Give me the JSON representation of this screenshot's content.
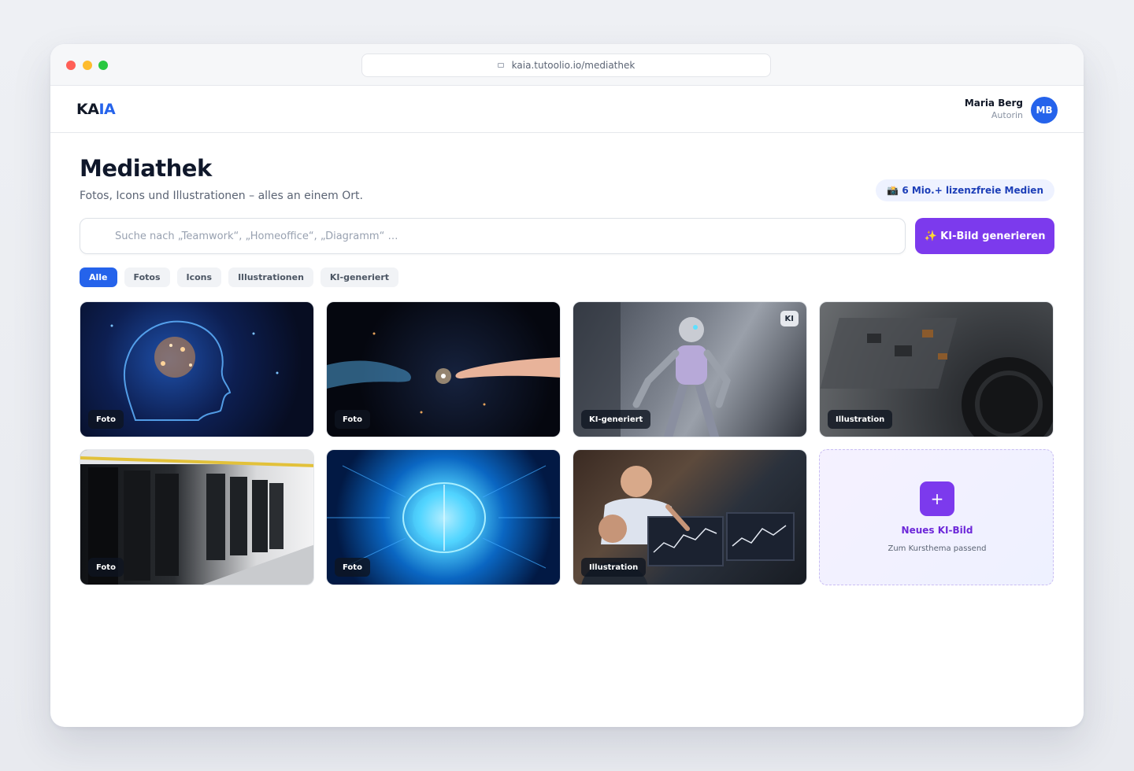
{
  "browser": {
    "url": "kaia.tutoolio.io/mediathek"
  },
  "header": {
    "logo_primary": "KA",
    "logo_accent": "IA",
    "user_name": "Maria Berg",
    "user_role": "Autorin",
    "avatar_initials": "MB"
  },
  "page": {
    "title": "Mediathek",
    "subtitle": "Fotos, Icons und Illustrationen – alles an einem Ort.",
    "media_badge": "📸 6 Mio.+ lizenzfreie Medien"
  },
  "search": {
    "placeholder": "Suche nach „Teamwork“, „Homeoffice“, „Diagramm“ …",
    "value": ""
  },
  "generate_button": "✨ KI-Bild generieren",
  "filters": [
    "Alle",
    "Fotos",
    "Icons",
    "Illustrationen",
    "KI-generiert"
  ],
  "active_filter": "Alle",
  "media": [
    {
      "tag": "Foto"
    },
    {
      "tag": "Foto"
    },
    {
      "tag": "KI-generiert",
      "corner_badge": "KI"
    },
    {
      "tag": "Illustration"
    },
    {
      "tag": "Foto"
    },
    {
      "tag": "Foto"
    },
    {
      "tag": "Illustration"
    }
  ],
  "new_card": {
    "icon": "+",
    "title": "Neues KI-Bild",
    "subtitle": "Zum Kursthema passend"
  },
  "colors": {
    "accent_blue": "#2563eb",
    "accent_purple": "#7c3aed"
  }
}
